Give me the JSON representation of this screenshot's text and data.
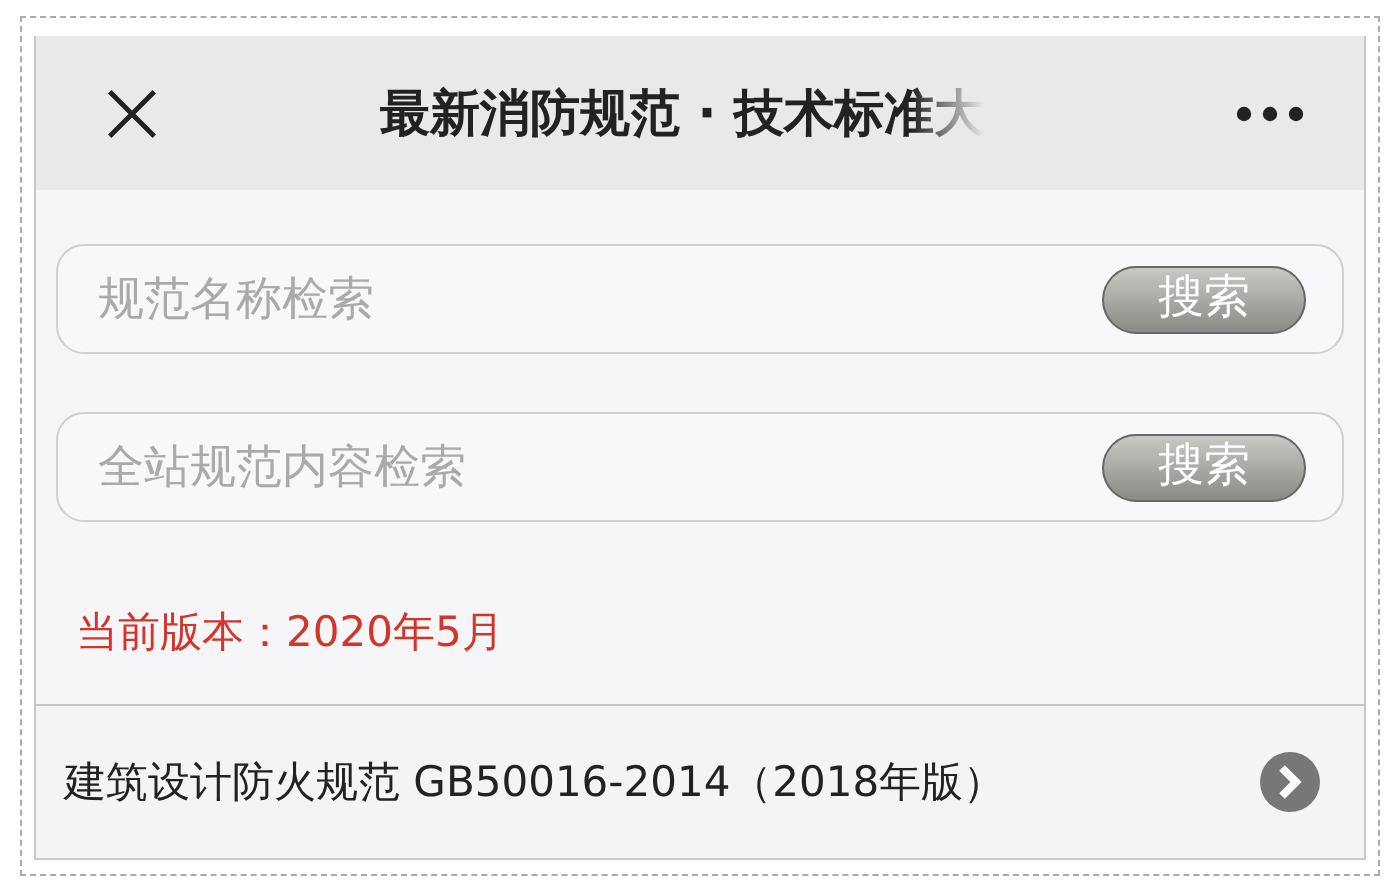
{
  "header": {
    "title": "最新消防规范 · 技术标准大"
  },
  "searches": [
    {
      "placeholder": "规范名称检索",
      "button": "搜索"
    },
    {
      "placeholder": "全站规范内容检索",
      "button": "搜索"
    }
  ],
  "version": "当前版本：2020年5月",
  "items": [
    {
      "label": "建筑设计防火规范 GB50016-2014（2018年版）"
    }
  ]
}
